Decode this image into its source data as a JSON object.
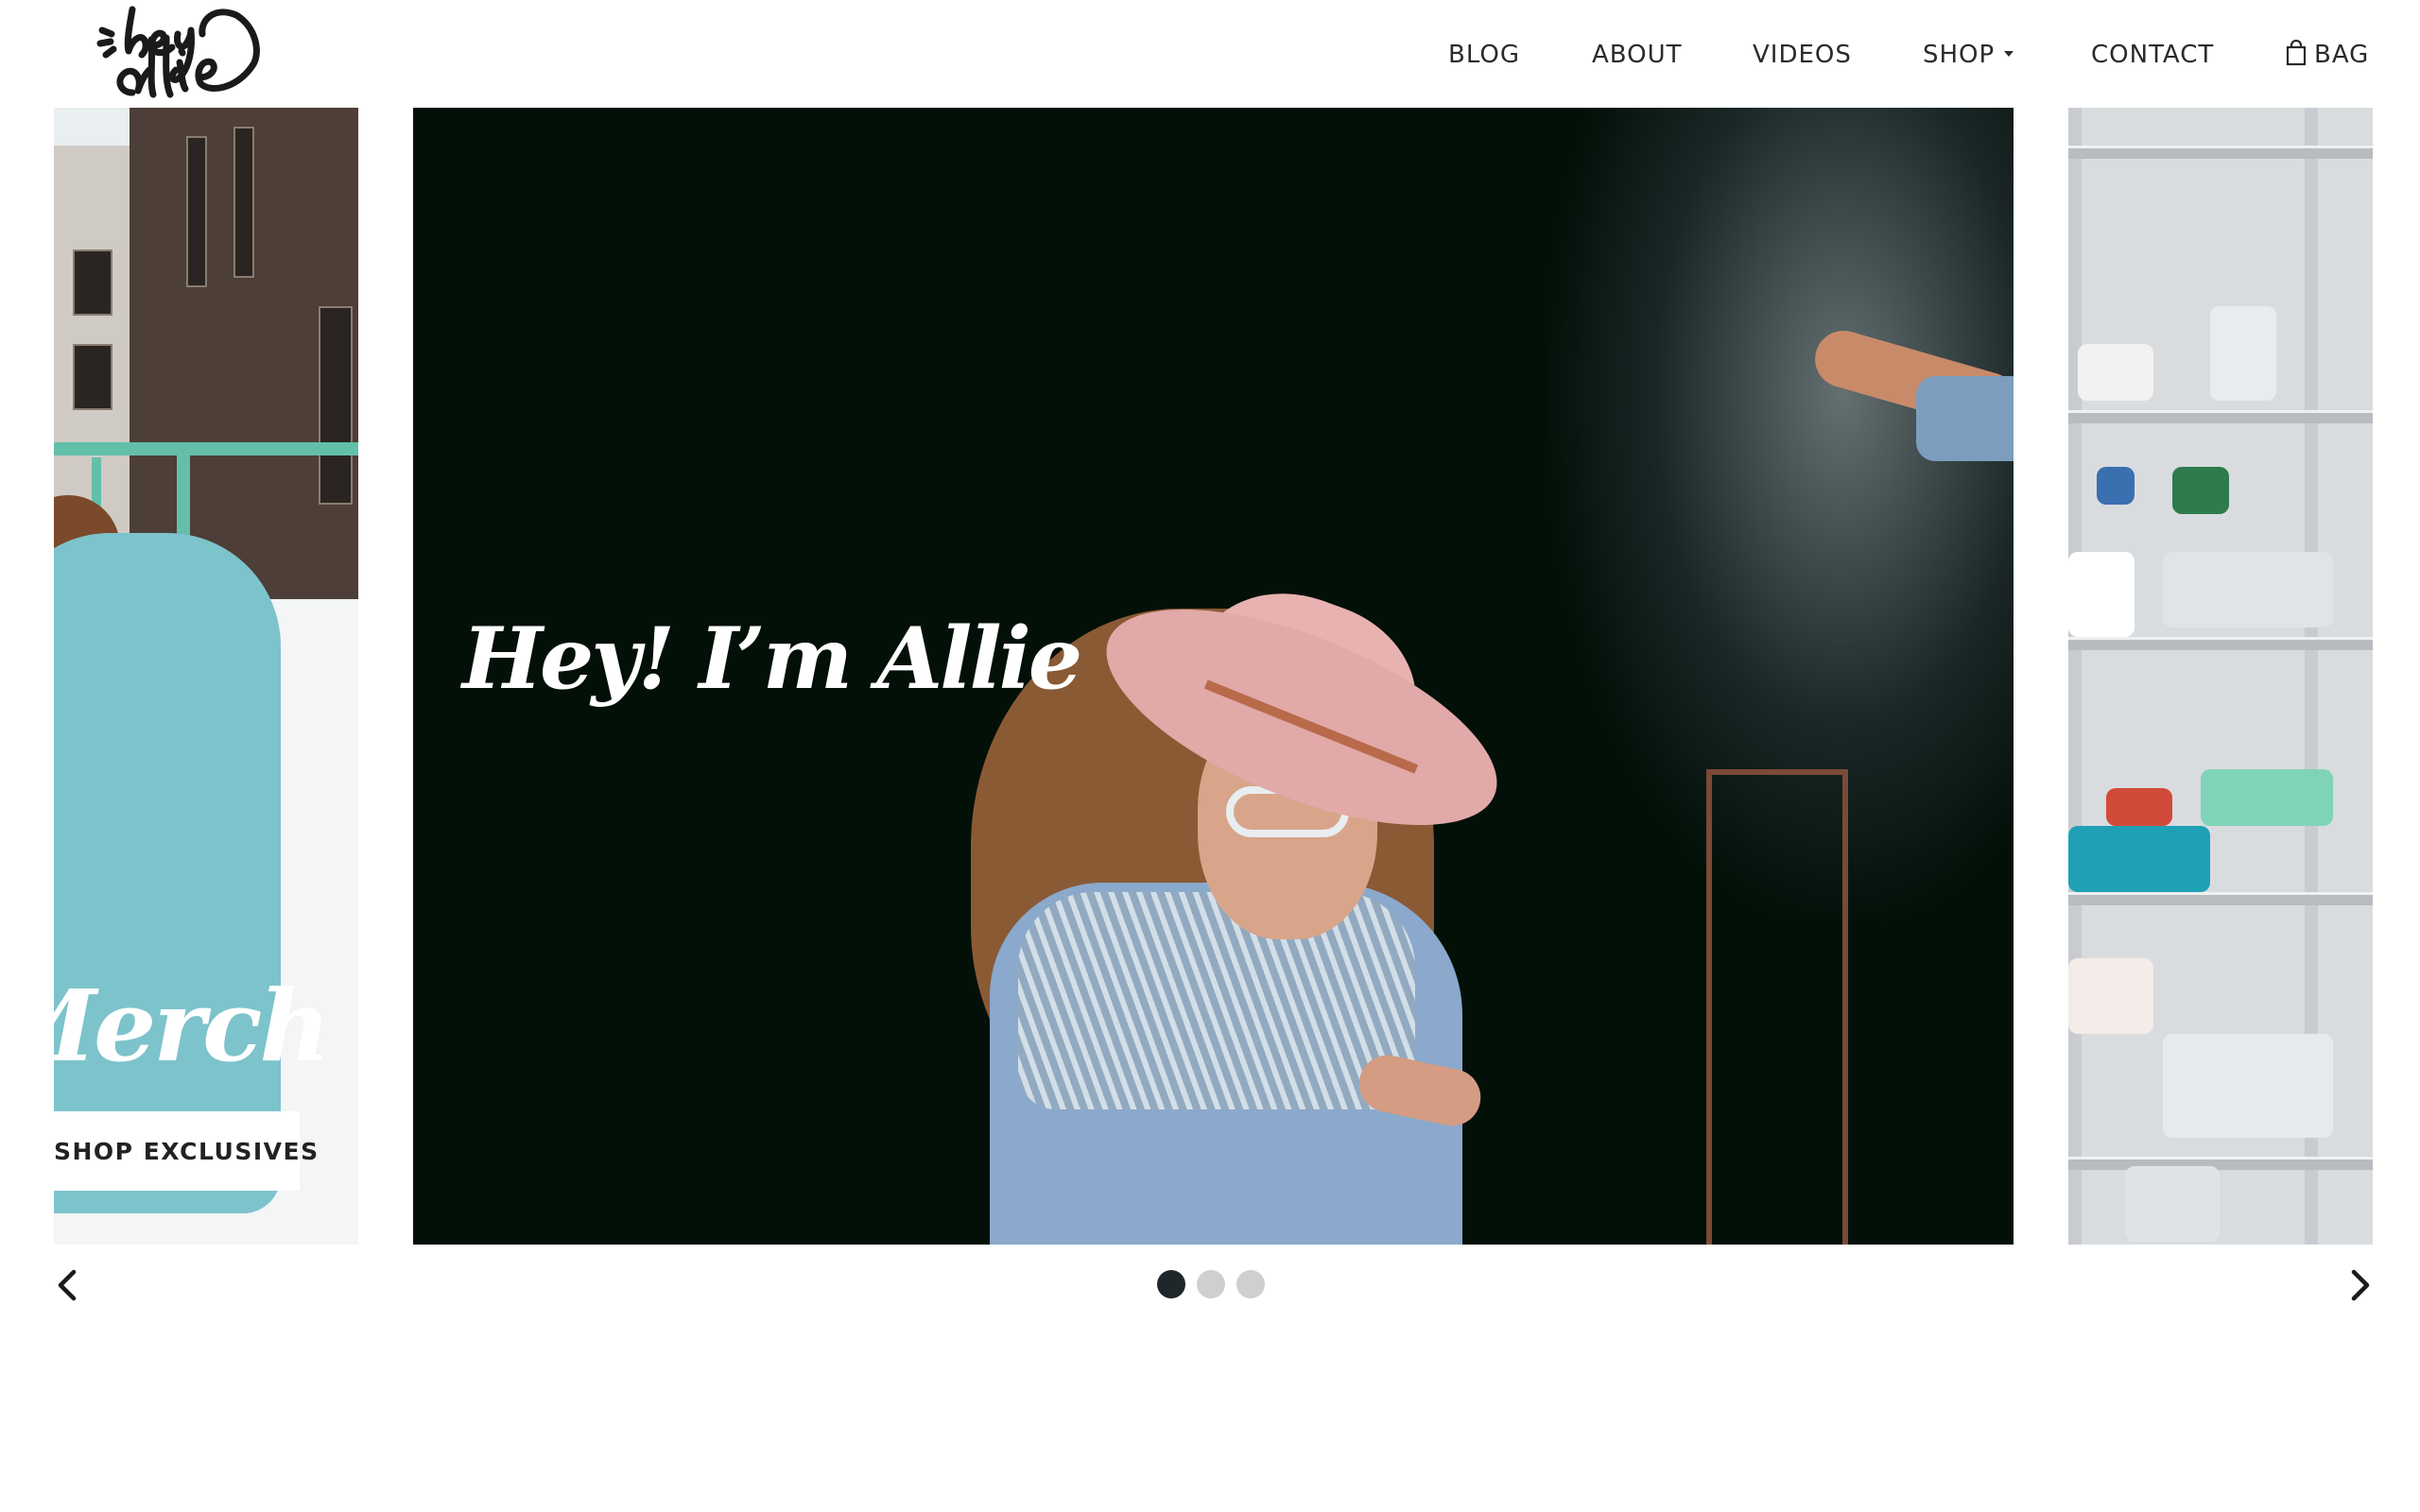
{
  "site": {
    "logo_text": "hey Allie"
  },
  "nav": {
    "items": [
      {
        "label": "BLOG"
      },
      {
        "label": "ABOUT"
      },
      {
        "label": "VIDEOS"
      },
      {
        "label": "SHOP",
        "has_dropdown": true
      },
      {
        "label": "CONTACT"
      }
    ],
    "bag_label": "BAG",
    "bag_icon": "shopping-bag-icon"
  },
  "carousel": {
    "slides": [
      {
        "title": "Merch",
        "button_label": "SHOP EXCLUSIVES"
      },
      {
        "title": "Hey! I’m Allie"
      },
      {
        "title": ""
      }
    ],
    "active_index": 0,
    "dot_count": 3,
    "prev_icon": "chevron-left-icon",
    "next_icon": "chevron-right-icon"
  },
  "colors": {
    "text": "#2a2a2a",
    "dot_active": "#1f272b",
    "dot_inactive": "#cfcfcf",
    "hero_bg": "#031008"
  }
}
